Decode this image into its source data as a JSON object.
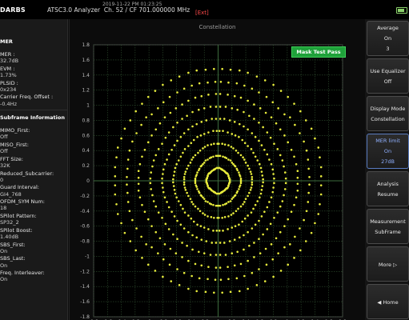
{
  "header": {
    "logo_text": "DARBS",
    "app_title": "ATSC3.0 Analyzer",
    "channel_info": "Ch. 52 / CF 701.000000 MHz",
    "timestamp": "2019-11-22 PM 01:23:25",
    "ext_label": "[Ext]",
    "battery_icon": "battery-icon"
  },
  "left_panel": {
    "items": [
      {
        "text": "MER",
        "kind": "header"
      },
      {
        "text": "MER :",
        "kind": "label"
      },
      {
        "text": "32.7dB",
        "kind": "value"
      },
      {
        "text": "EVM :",
        "kind": "label"
      },
      {
        "text": "1.73%",
        "kind": "value"
      },
      {
        "text": "PLSID :",
        "kind": "label"
      },
      {
        "text": "0x234",
        "kind": "value"
      },
      {
        "text": "Carrier Freq. Offset :",
        "kind": "label"
      },
      {
        "text": "-0.4Hz",
        "kind": "value"
      },
      {
        "text": "Subframe Information",
        "kind": "header"
      },
      {
        "text": "MIMO_First:",
        "kind": "label"
      },
      {
        "text": "Off",
        "kind": "value"
      },
      {
        "text": "MISO_First:",
        "kind": "label"
      },
      {
        "text": "Off",
        "kind": "value"
      },
      {
        "text": "FFT Size:",
        "kind": "label"
      },
      {
        "text": "32K",
        "kind": "value"
      },
      {
        "text": "Reduced_Subcarrier:",
        "kind": "label"
      },
      {
        "text": "0",
        "kind": "value"
      },
      {
        "text": "Guard Interval:",
        "kind": "label"
      },
      {
        "text": "GI4_768",
        "kind": "value"
      },
      {
        "text": "OFDM_SYM Num:",
        "kind": "label"
      },
      {
        "text": "18",
        "kind": "value"
      },
      {
        "text": "SPilot Pattern:",
        "kind": "label"
      },
      {
        "text": "SP32_2",
        "kind": "value"
      },
      {
        "text": "SPilot Boost:",
        "kind": "label"
      },
      {
        "text": "1.40dB",
        "kind": "value"
      },
      {
        "text": "SBS_First:",
        "kind": "label"
      },
      {
        "text": "On",
        "kind": "value"
      },
      {
        "text": "SBS_Last:",
        "kind": "label"
      },
      {
        "text": "On",
        "kind": "value"
      },
      {
        "text": "Freq. Interleaver:",
        "kind": "label"
      },
      {
        "text": "On",
        "kind": "value"
      }
    ]
  },
  "plot": {
    "title": "Constellation",
    "mask_badge": "Mask Test Pass",
    "point_color": "#e8ec3c",
    "grid_color": "#2f4f2f",
    "axis_color": "#3d6b3d"
  },
  "chart_data": {
    "type": "scatter",
    "title": "Constellation",
    "xlim": [
      -1.8,
      1.8
    ],
    "ylim": [
      -1.8,
      1.8
    ],
    "xticks": [
      "-1.8",
      "-1.6",
      "-1.4",
      "-1.2",
      "-1",
      "-0.8",
      "-0.6",
      "-0.4",
      "-0.2",
      "0",
      "0.2",
      "0.4",
      "0.6",
      "0.8",
      "1",
      "1.2",
      "1.4",
      "1.6",
      "1.8"
    ],
    "yticks": [
      "1.8",
      "1.6",
      "1.4",
      "1.2",
      "1",
      "0.8",
      "0.6",
      "0.4",
      "0.2",
      "0",
      "-0.2",
      "-0.4",
      "-0.6",
      "-0.8",
      "-1",
      "-1.2",
      "-1.4",
      "-1.6",
      "-1.8"
    ],
    "grid": true,
    "points": [
      [
        0.06,
        1.48
      ],
      [
        0.18,
        1.47
      ],
      [
        0.31,
        1.46
      ],
      [
        0.43,
        1.43
      ],
      [
        0.56,
        1.38
      ],
      [
        0.68,
        1.33
      ],
      [
        0.8,
        1.27
      ],
      [
        0.91,
        1.19
      ],
      [
        1.01,
        1.11
      ],
      [
        1.1,
        1.02
      ],
      [
        0.04,
        1.31
      ],
      [
        0.15,
        1.3
      ],
      [
        0.27,
        1.29
      ],
      [
        0.38,
        1.26
      ],
      [
        0.49,
        1.22
      ],
      [
        0.59,
        1.17
      ],
      [
        0.7,
        1.11
      ],
      [
        0.79,
        1.04
      ],
      [
        0.87,
        0.96
      ],
      [
        0.96,
        0.88
      ],
      [
        0.03,
        1.15
      ],
      [
        0.14,
        1.14
      ],
      [
        0.24,
        1.12
      ],
      [
        0.33,
        1.1
      ],
      [
        0.43,
        1.06
      ],
      [
        0.52,
        1.01
      ],
      [
        0.61,
        0.96
      ],
      [
        0.69,
        0.9
      ],
      [
        0.77,
        0.84
      ],
      [
        0.84,
        0.76
      ],
      [
        0.03,
        0.98
      ],
      [
        0.11,
        0.98
      ],
      [
        0.2,
        0.96
      ],
      [
        0.28,
        0.94
      ],
      [
        0.37,
        0.91
      ],
      [
        0.45,
        0.86
      ],
      [
        0.52,
        0.82
      ],
      [
        0.59,
        0.77
      ],
      [
        0.65,
        0.71
      ],
      [
        0.71,
        0.64
      ],
      [
        0.03,
        0.82
      ],
      [
        0.09,
        0.82
      ],
      [
        0.17,
        0.8
      ],
      [
        0.24,
        0.78
      ],
      [
        0.31,
        0.75
      ],
      [
        0.37,
        0.72
      ],
      [
        0.43,
        0.68
      ],
      [
        0.49,
        0.63
      ],
      [
        0.54,
        0.58
      ],
      [
        0.59,
        0.53
      ],
      [
        0.02,
        0.66
      ],
      [
        0.07,
        0.66
      ],
      [
        0.14,
        0.64
      ],
      [
        0.2,
        0.62
      ],
      [
        0.25,
        0.6
      ],
      [
        0.3,
        0.58
      ],
      [
        0.35,
        0.54
      ],
      [
        0.39,
        0.5
      ],
      [
        0.43,
        0.46
      ],
      [
        0.48,
        0.42
      ],
      [
        0.01,
        0.49
      ],
      [
        0.06,
        0.49
      ],
      [
        0.1,
        0.48
      ],
      [
        0.15,
        0.47
      ],
      [
        0.19,
        0.45
      ],
      [
        0.22,
        0.43
      ],
      [
        0.26,
        0.4
      ],
      [
        0.29,
        0.37
      ],
      [
        0.33,
        0.34
      ],
      [
        0.36,
        0.31
      ],
      [
        0.01,
        0.33
      ],
      [
        0.03,
        0.33
      ],
      [
        0.07,
        0.32
      ],
      [
        0.1,
        0.31
      ],
      [
        0.12,
        0.3
      ],
      [
        0.15,
        0.28
      ],
      [
        0.18,
        0.27
      ],
      [
        0.2,
        0.24
      ],
      [
        0.22,
        0.22
      ],
      [
        0.24,
        0.2
      ],
      [
        0.01,
        0.17
      ],
      [
        0.02,
        0.17
      ],
      [
        0.04,
        0.16
      ],
      [
        0.05,
        0.15
      ],
      [
        0.06,
        0.15
      ],
      [
        0.07,
        0.14
      ],
      [
        0.09,
        0.13
      ],
      [
        0.1,
        0.12
      ],
      [
        0.11,
        0.11
      ],
      [
        0.12,
        0.1
      ],
      [
        1.19,
        0.92
      ],
      [
        1.27,
        0.8
      ],
      [
        1.35,
        0.69
      ],
      [
        1.4,
        0.56
      ],
      [
        1.45,
        0.44
      ],
      [
        1.47,
        0.31
      ],
      [
        1.49,
        0.18
      ],
      [
        1.49,
        0.06
      ],
      [
        1.04,
        0.84
      ],
      [
        1.11,
        0.74
      ],
      [
        1.18,
        0.63
      ],
      [
        1.24,
        0.52
      ],
      [
        1.28,
        0.4
      ],
      [
        1.3,
        0.28
      ],
      [
        1.31,
        0.16
      ],
      [
        1.32,
        0.05
      ],
      [
        0.9,
        0.68
      ],
      [
        0.96,
        0.6
      ],
      [
        1.01,
        0.51
      ],
      [
        1.06,
        0.41
      ],
      [
        1.1,
        0.32
      ],
      [
        1.13,
        0.22
      ],
      [
        1.15,
        0.13
      ],
      [
        1.15,
        0.04
      ],
      [
        0.76,
        0.57
      ],
      [
        0.81,
        0.49
      ],
      [
        0.86,
        0.42
      ],
      [
        0.9,
        0.34
      ],
      [
        0.93,
        0.27
      ],
      [
        0.95,
        0.19
      ],
      [
        0.97,
        0.11
      ],
      [
        0.98,
        0.03
      ],
      [
        0.63,
        0.47
      ],
      [
        0.67,
        0.41
      ],
      [
        0.71,
        0.35
      ],
      [
        0.74,
        0.28
      ],
      [
        0.77,
        0.22
      ],
      [
        0.79,
        0.15
      ],
      [
        0.8,
        0.09
      ],
      [
        0.81,
        0.03
      ],
      [
        0.51,
        0.37
      ],
      [
        0.54,
        0.32
      ],
      [
        0.57,
        0.27
      ],
      [
        0.6,
        0.22
      ],
      [
        0.62,
        0.17
      ],
      [
        0.63,
        0.12
      ],
      [
        0.64,
        0.07
      ],
      [
        0.65,
        0.02
      ],
      [
        0.38,
        0.28
      ],
      [
        0.4,
        0.24
      ],
      [
        0.43,
        0.2
      ],
      [
        0.45,
        0.16
      ],
      [
        0.47,
        0.12
      ],
      [
        0.48,
        0.09
      ],
      [
        0.49,
        0.05
      ],
      [
        0.49,
        0.02
      ],
      [
        0.25,
        0.19
      ],
      [
        0.27,
        0.16
      ],
      [
        0.28,
        0.14
      ],
      [
        0.3,
        0.11
      ],
      [
        0.31,
        0.08
      ],
      [
        0.32,
        0.06
      ],
      [
        0.33,
        0.03
      ],
      [
        0.33,
        0.01
      ],
      [
        0.13,
        0.1
      ],
      [
        0.14,
        0.09
      ],
      [
        0.15,
        0.07
      ],
      [
        0.15,
        0.06
      ],
      [
        0.16,
        0.04
      ],
      [
        0.16,
        0.03
      ],
      [
        0.17,
        0.02
      ],
      [
        0.17,
        0.0
      ]
    ],
    "symmetry": "quadrant-mirrored"
  },
  "right_panel": {
    "buttons": [
      {
        "lines": [
          "Average",
          "On",
          "3"
        ]
      },
      {
        "lines": [
          "Use Equalizer",
          "Off"
        ]
      },
      {
        "lines": [
          "Display Mode",
          "Constellation"
        ]
      },
      {
        "lines": [
          "MER limit",
          "On",
          "27dB"
        ],
        "active": true
      },
      {
        "lines": [
          "Analysis",
          "Resume"
        ]
      },
      {
        "lines": [
          "Measurement",
          "SubFrame"
        ]
      },
      {
        "lines": [
          "More ▷"
        ]
      },
      {
        "lines": [
          "◀ Home"
        ]
      }
    ]
  }
}
